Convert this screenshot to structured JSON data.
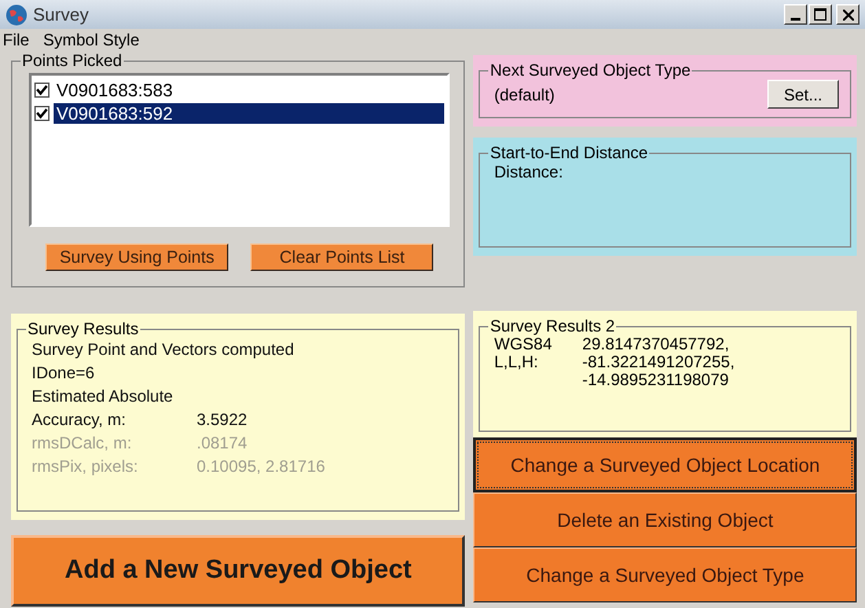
{
  "window": {
    "title": "Survey"
  },
  "menu": [
    "File",
    "Symbol Style"
  ],
  "points_picked": {
    "title": "Points Picked",
    "items": [
      {
        "label": "V0901683:583",
        "checked": true,
        "selected": false
      },
      {
        "label": "V0901683:592",
        "checked": true,
        "selected": true
      }
    ],
    "buttons": [
      "Survey Using Points",
      "Clear Points List"
    ]
  },
  "survey_results": {
    "title": "Survey Results",
    "lines": [
      {
        "label": "Survey Point and Vectors computed",
        "dimmed": false
      },
      {
        "label": "IDone=6",
        "dimmed": false
      },
      {
        "label": "Estimated Absolute",
        "dimmed": false
      },
      {
        "label": "Accuracy, m:",
        "value": "3.5922",
        "dimmed": false
      },
      {
        "label": "rmsDCalc, m:",
        "value": ".08174",
        "dimmed": true
      },
      {
        "label": "rmsPix, pixels:",
        "value": "0.10095, 2.81716",
        "dimmed": true
      }
    ]
  },
  "add_button": "Add a New Surveyed Object",
  "next_type": {
    "title": "Next Surveyed Object Type",
    "value": "(default)",
    "button": "Set..."
  },
  "distance": {
    "title": "Start-to-End Distance",
    "label": "Distance:"
  },
  "survey_results_2": {
    "title": "Survey Results 2",
    "labels": [
      "WGS84",
      "L,L,H:"
    ],
    "values": [
      "29.8147370457792,",
      "-81.3221491207255,",
      "-14.9895231198079"
    ]
  },
  "actions": [
    {
      "label": "Change a Surveyed Object Location",
      "focused": true
    },
    {
      "label": "Delete an Existing Object",
      "focused": false
    },
    {
      "label": "Change a Surveyed Object Type",
      "focused": false
    }
  ]
}
